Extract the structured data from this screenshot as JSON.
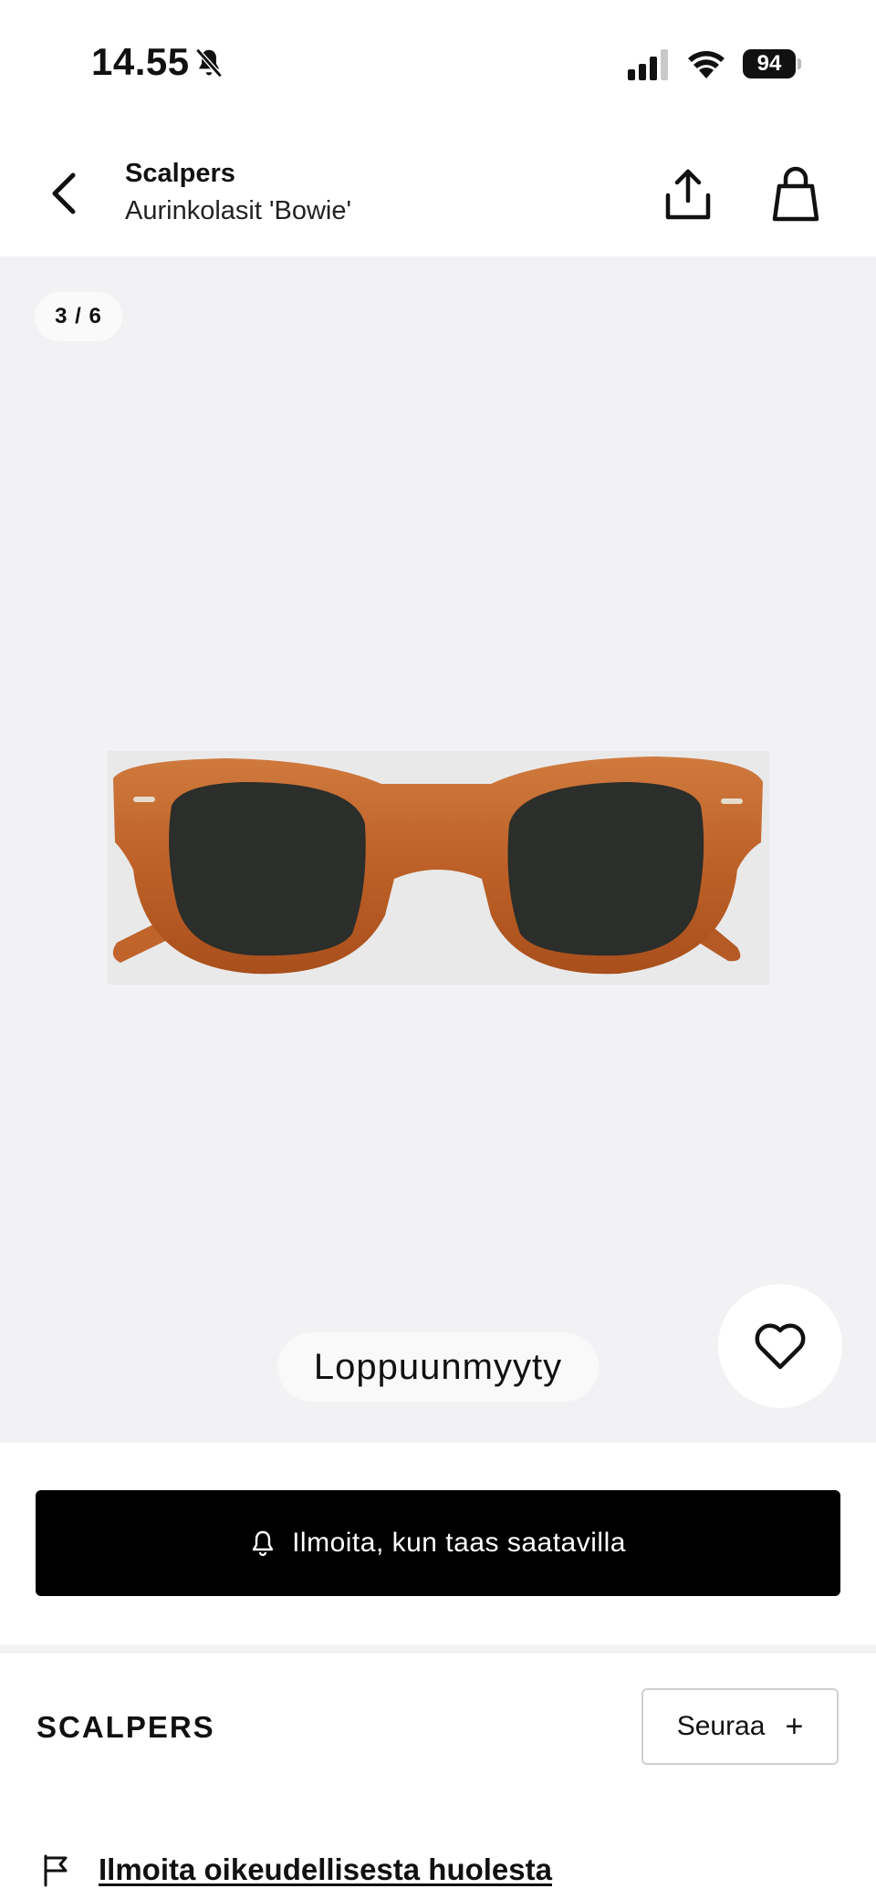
{
  "status_bar": {
    "time": "14.55",
    "battery": "94",
    "icons": [
      "bell-off-icon",
      "cellular-signal-icon",
      "wifi-icon",
      "battery-icon"
    ]
  },
  "header": {
    "brand": "Scalpers",
    "product_name": "Aurinkolasit 'Bowie'",
    "icons": [
      "back-chevron-icon",
      "share-icon",
      "shopping-bag-icon"
    ]
  },
  "gallery": {
    "counter": "3 / 6",
    "availability": "Loppuunmyyty"
  },
  "actions": {
    "notify_label": "Ilmoita, kun taas saatavilla"
  },
  "brand_section": {
    "heading": "SCALPERS",
    "follow_label": "Seuraa",
    "follow_symbol": "+"
  },
  "report": {
    "label": "Ilmoita oikeudellisesta huolesta"
  },
  "colors": {
    "gallery_background": "#f2f2f4",
    "primary_button": "#000000",
    "frame_tortoise": "#c0642b",
    "lens": "#2b2e2a"
  }
}
